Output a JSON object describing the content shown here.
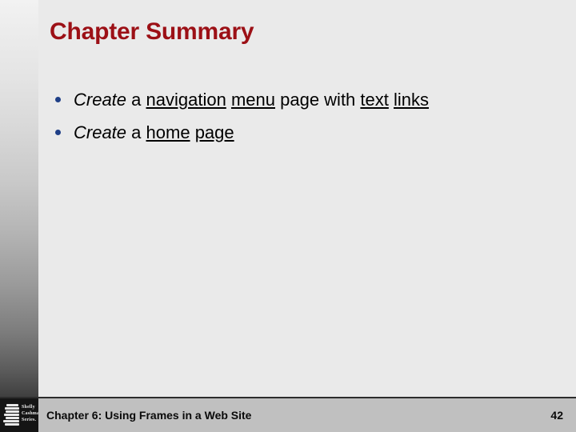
{
  "slide": {
    "title": "Chapter Summary",
    "title_color": "#9c1016",
    "background_color": "#eaeaea",
    "bullets": [
      {
        "marker": "bullet-dot",
        "segments": [
          {
            "text": "Create",
            "style": "italic"
          },
          {
            "text": " a ",
            "style": "plain"
          },
          {
            "text": "navigation",
            "style": "underline"
          },
          {
            "text": " ",
            "style": "plain"
          },
          {
            "text": "menu",
            "style": "underline"
          },
          {
            "text": " page with ",
            "style": "plain"
          },
          {
            "text": "text",
            "style": "underline"
          },
          {
            "text": " ",
            "style": "plain"
          },
          {
            "text": "links",
            "style": "underline"
          }
        ],
        "plain_text": "Create a navigation menu page with text links"
      },
      {
        "marker": "bullet-dot",
        "segments": [
          {
            "text": "Create",
            "style": "italic"
          },
          {
            "text": " a ",
            "style": "plain"
          },
          {
            "text": "home",
            "style": "underline"
          },
          {
            "text": " ",
            "style": "plain"
          },
          {
            "text": "page",
            "style": "underline"
          }
        ],
        "plain_text": "Create a home page"
      }
    ]
  },
  "footer": {
    "logo": {
      "icon": "stacked-books-icon",
      "line1": "Shelly",
      "line2": "Cashman",
      "line3": "Series."
    },
    "text": "Chapter 6: Using Frames in a Web Site",
    "page_number": "42",
    "bar_color": "#c0c0c0"
  }
}
